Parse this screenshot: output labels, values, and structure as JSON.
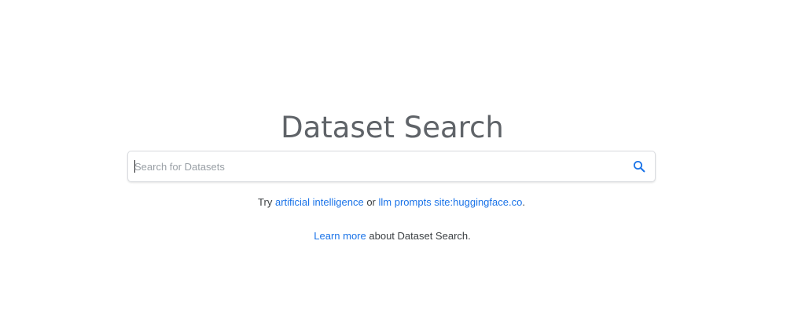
{
  "page": {
    "title": "Dataset Search"
  },
  "search": {
    "placeholder": "Search for Datasets",
    "value": "",
    "icon": "search-icon"
  },
  "suggestions": {
    "prefix": "Try",
    "first_link": "artificial intelligence",
    "separator": "or",
    "second_link": "llm prompts site:huggingface.co",
    "suffix": "."
  },
  "about": {
    "link_text": "Learn more",
    "rest_text": "about Dataset Search."
  },
  "colors": {
    "title": "#5f6368",
    "link": "#1a73e8",
    "text": "#3c4043",
    "border": "#dadce0",
    "icon": "#1a73e8"
  }
}
